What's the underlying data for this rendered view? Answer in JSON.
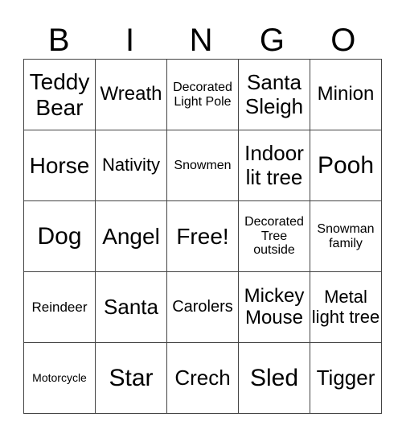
{
  "header": [
    "B",
    "I",
    "N",
    "G",
    "O"
  ],
  "rows": [
    [
      "Teddy Bear",
      "Wreath",
      "Decorated Light Pole",
      "Santa Sleigh",
      "Minion"
    ],
    [
      "Horse",
      "Nativity",
      "Snowmen",
      "Indoor lit tree",
      "Pooh"
    ],
    [
      "Dog",
      "Angel",
      "Free!",
      "Decorated Tree outside",
      "Snowman family"
    ],
    [
      "Reindeer",
      "Santa",
      "Carolers",
      "Mickey Mouse",
      "Metal light tree"
    ],
    [
      "Motorcycle",
      "Star",
      "Crech",
      "Sled",
      "Tigger"
    ]
  ]
}
